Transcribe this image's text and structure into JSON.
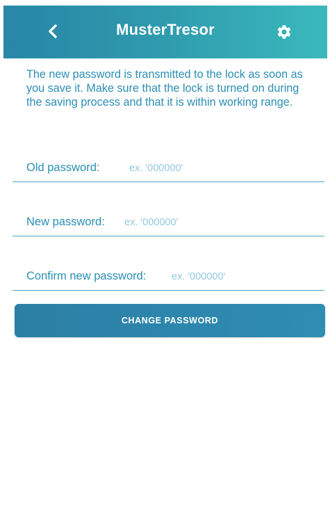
{
  "header": {
    "title": "MusterTresor",
    "back_icon": "chevron-left-icon",
    "settings_icon": "gear-icon"
  },
  "info_text": "The new password is transmitted to the lock as soon as you save it. Make sure that the lock is turned on during the saving process and that it is within working range.",
  "form": {
    "old_password": {
      "label": "Old password:",
      "placeholder": "ex. '000000'",
      "value": ""
    },
    "new_password": {
      "label": "New password:",
      "placeholder": "ex. '000000'",
      "value": ""
    },
    "confirm_password": {
      "label": "Confirm new password:",
      "placeholder": "ex. '000000'",
      "value": ""
    }
  },
  "change_button_label": "CHANGE PASSWORD",
  "colors": {
    "accent": "#2a8fb4",
    "header_start": "#2886a6",
    "header_end": "#3ab9bc",
    "placeholder": "#93c9dc",
    "button": "#2d86ac"
  }
}
